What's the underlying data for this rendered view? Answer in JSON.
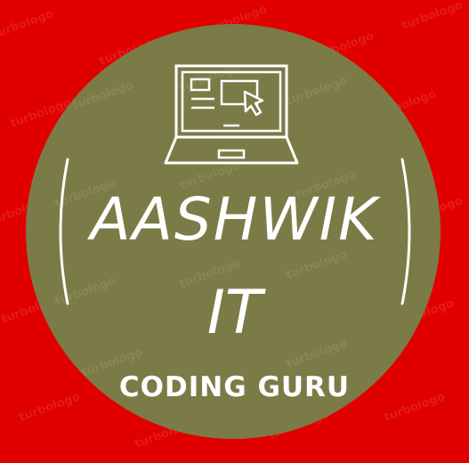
{
  "logo": {
    "title_line1": "AASHWIK",
    "title_line2": "IT",
    "tagline": "CODING GURU",
    "icon": "laptop-cursor-icon",
    "colors": {
      "background": "#e00000",
      "badge": "#7b7b47",
      "text": "#ffffff"
    }
  },
  "watermark": {
    "text": "turbologo"
  }
}
